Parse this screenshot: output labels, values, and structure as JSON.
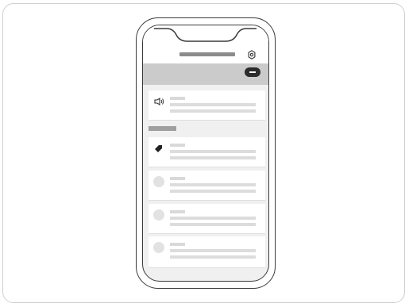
{
  "app": {
    "title": "",
    "icons": {
      "settings": "gear-icon",
      "announcement": "speaker-icon",
      "tag": "tag-icon"
    },
    "colors": {
      "toolbar": "#cbcbcb",
      "pill": "#2b2b2b",
      "section_label": "#9f9f9f"
    }
  },
  "rows": [
    {
      "kind": "announcement",
      "icon": "speaker-icon"
    },
    {
      "kind": "tag",
      "icon": "tag-icon"
    },
    {
      "kind": "placeholder",
      "icon": "avatar"
    },
    {
      "kind": "placeholder",
      "icon": "avatar"
    },
    {
      "kind": "placeholder",
      "icon": "avatar"
    }
  ]
}
